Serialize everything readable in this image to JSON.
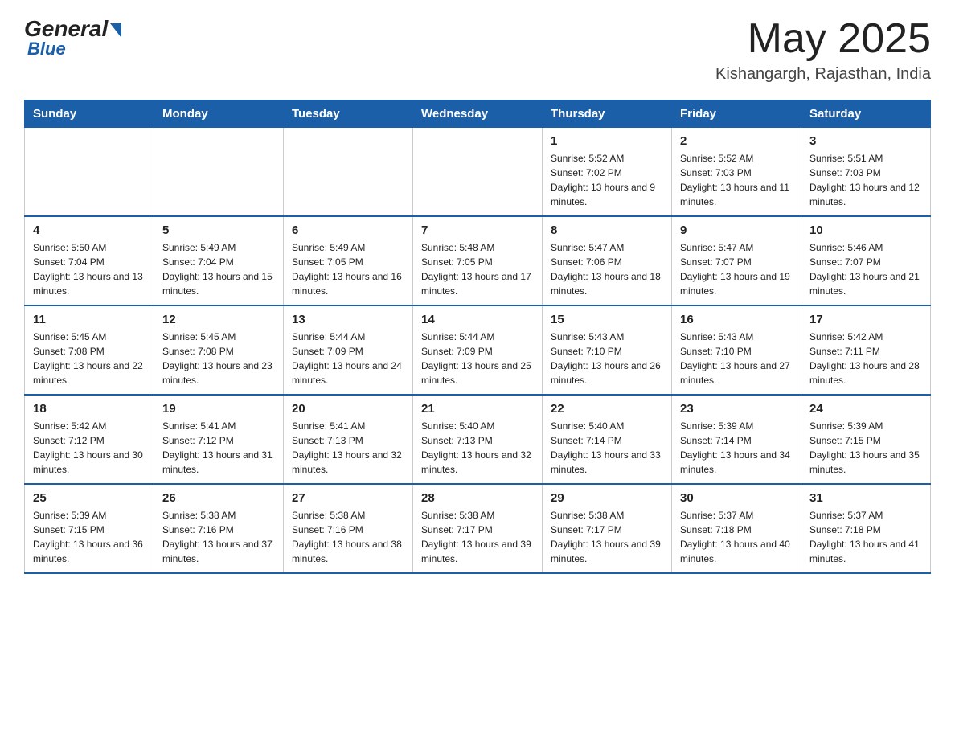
{
  "header": {
    "logo_general": "General",
    "logo_blue": "Blue",
    "title": "May 2025",
    "location": "Kishangargh, Rajasthan, India"
  },
  "days_of_week": [
    "Sunday",
    "Monday",
    "Tuesday",
    "Wednesday",
    "Thursday",
    "Friday",
    "Saturday"
  ],
  "weeks": [
    [
      {
        "day": "",
        "info": ""
      },
      {
        "day": "",
        "info": ""
      },
      {
        "day": "",
        "info": ""
      },
      {
        "day": "",
        "info": ""
      },
      {
        "day": "1",
        "info": "Sunrise: 5:52 AM\nSunset: 7:02 PM\nDaylight: 13 hours and 9 minutes."
      },
      {
        "day": "2",
        "info": "Sunrise: 5:52 AM\nSunset: 7:03 PM\nDaylight: 13 hours and 11 minutes."
      },
      {
        "day": "3",
        "info": "Sunrise: 5:51 AM\nSunset: 7:03 PM\nDaylight: 13 hours and 12 minutes."
      }
    ],
    [
      {
        "day": "4",
        "info": "Sunrise: 5:50 AM\nSunset: 7:04 PM\nDaylight: 13 hours and 13 minutes."
      },
      {
        "day": "5",
        "info": "Sunrise: 5:49 AM\nSunset: 7:04 PM\nDaylight: 13 hours and 15 minutes."
      },
      {
        "day": "6",
        "info": "Sunrise: 5:49 AM\nSunset: 7:05 PM\nDaylight: 13 hours and 16 minutes."
      },
      {
        "day": "7",
        "info": "Sunrise: 5:48 AM\nSunset: 7:05 PM\nDaylight: 13 hours and 17 minutes."
      },
      {
        "day": "8",
        "info": "Sunrise: 5:47 AM\nSunset: 7:06 PM\nDaylight: 13 hours and 18 minutes."
      },
      {
        "day": "9",
        "info": "Sunrise: 5:47 AM\nSunset: 7:07 PM\nDaylight: 13 hours and 19 minutes."
      },
      {
        "day": "10",
        "info": "Sunrise: 5:46 AM\nSunset: 7:07 PM\nDaylight: 13 hours and 21 minutes."
      }
    ],
    [
      {
        "day": "11",
        "info": "Sunrise: 5:45 AM\nSunset: 7:08 PM\nDaylight: 13 hours and 22 minutes."
      },
      {
        "day": "12",
        "info": "Sunrise: 5:45 AM\nSunset: 7:08 PM\nDaylight: 13 hours and 23 minutes."
      },
      {
        "day": "13",
        "info": "Sunrise: 5:44 AM\nSunset: 7:09 PM\nDaylight: 13 hours and 24 minutes."
      },
      {
        "day": "14",
        "info": "Sunrise: 5:44 AM\nSunset: 7:09 PM\nDaylight: 13 hours and 25 minutes."
      },
      {
        "day": "15",
        "info": "Sunrise: 5:43 AM\nSunset: 7:10 PM\nDaylight: 13 hours and 26 minutes."
      },
      {
        "day": "16",
        "info": "Sunrise: 5:43 AM\nSunset: 7:10 PM\nDaylight: 13 hours and 27 minutes."
      },
      {
        "day": "17",
        "info": "Sunrise: 5:42 AM\nSunset: 7:11 PM\nDaylight: 13 hours and 28 minutes."
      }
    ],
    [
      {
        "day": "18",
        "info": "Sunrise: 5:42 AM\nSunset: 7:12 PM\nDaylight: 13 hours and 30 minutes."
      },
      {
        "day": "19",
        "info": "Sunrise: 5:41 AM\nSunset: 7:12 PM\nDaylight: 13 hours and 31 minutes."
      },
      {
        "day": "20",
        "info": "Sunrise: 5:41 AM\nSunset: 7:13 PM\nDaylight: 13 hours and 32 minutes."
      },
      {
        "day": "21",
        "info": "Sunrise: 5:40 AM\nSunset: 7:13 PM\nDaylight: 13 hours and 32 minutes."
      },
      {
        "day": "22",
        "info": "Sunrise: 5:40 AM\nSunset: 7:14 PM\nDaylight: 13 hours and 33 minutes."
      },
      {
        "day": "23",
        "info": "Sunrise: 5:39 AM\nSunset: 7:14 PM\nDaylight: 13 hours and 34 minutes."
      },
      {
        "day": "24",
        "info": "Sunrise: 5:39 AM\nSunset: 7:15 PM\nDaylight: 13 hours and 35 minutes."
      }
    ],
    [
      {
        "day": "25",
        "info": "Sunrise: 5:39 AM\nSunset: 7:15 PM\nDaylight: 13 hours and 36 minutes."
      },
      {
        "day": "26",
        "info": "Sunrise: 5:38 AM\nSunset: 7:16 PM\nDaylight: 13 hours and 37 minutes."
      },
      {
        "day": "27",
        "info": "Sunrise: 5:38 AM\nSunset: 7:16 PM\nDaylight: 13 hours and 38 minutes."
      },
      {
        "day": "28",
        "info": "Sunrise: 5:38 AM\nSunset: 7:17 PM\nDaylight: 13 hours and 39 minutes."
      },
      {
        "day": "29",
        "info": "Sunrise: 5:38 AM\nSunset: 7:17 PM\nDaylight: 13 hours and 39 minutes."
      },
      {
        "day": "30",
        "info": "Sunrise: 5:37 AM\nSunset: 7:18 PM\nDaylight: 13 hours and 40 minutes."
      },
      {
        "day": "31",
        "info": "Sunrise: 5:37 AM\nSunset: 7:18 PM\nDaylight: 13 hours and 41 minutes."
      }
    ]
  ]
}
